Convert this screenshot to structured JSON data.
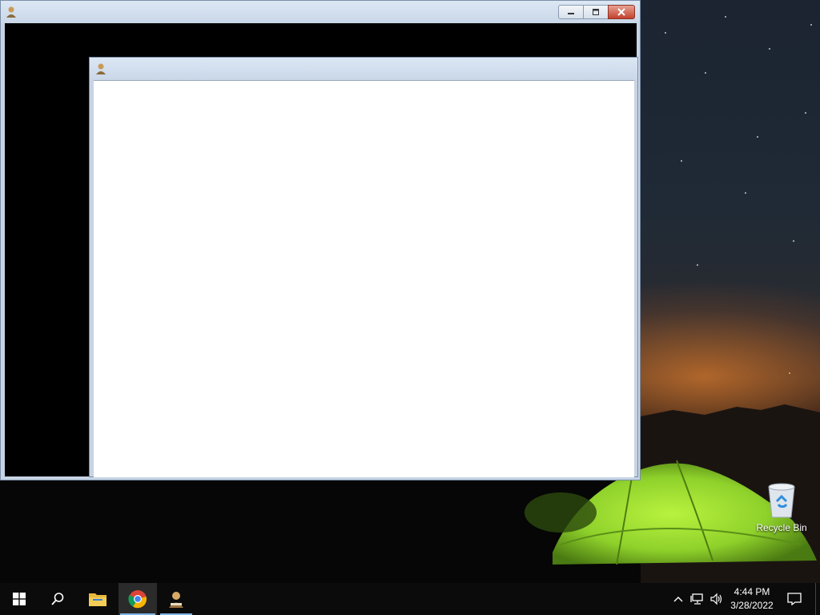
{
  "desktop": {
    "icons": [
      {
        "label": "Recycle Bin",
        "icon": "recycle-bin-icon"
      }
    ]
  },
  "outer_window": {
    "title": "",
    "icon": "app-person-icon",
    "buttons": {
      "minimize": "minimize-icon",
      "maximize": "maximize-icon",
      "close": "close-icon"
    }
  },
  "inner_window": {
    "title": "",
    "icon": "app-person-icon"
  },
  "taskbar": {
    "items": [
      {
        "name": "start",
        "icon": "windows-logo-icon"
      },
      {
        "name": "search",
        "icon": "search-icon"
      },
      {
        "name": "file-explorer",
        "icon": "folder-icon"
      },
      {
        "name": "chrome",
        "icon": "chrome-icon",
        "active": true
      },
      {
        "name": "app",
        "icon": "app-person-icon",
        "running": true
      }
    ],
    "tray": {
      "icons": [
        "chevron-up-icon",
        "network-icon",
        "volume-icon"
      ],
      "time": "4:44 PM",
      "date": "3/28/2022",
      "notification_icon": "action-center-icon"
    }
  },
  "colors": {
    "taskbar": "#0b0b0b",
    "accent_underline": "#7fb4e6",
    "close_button": "#c5412d",
    "tent": "#8fd12b"
  }
}
